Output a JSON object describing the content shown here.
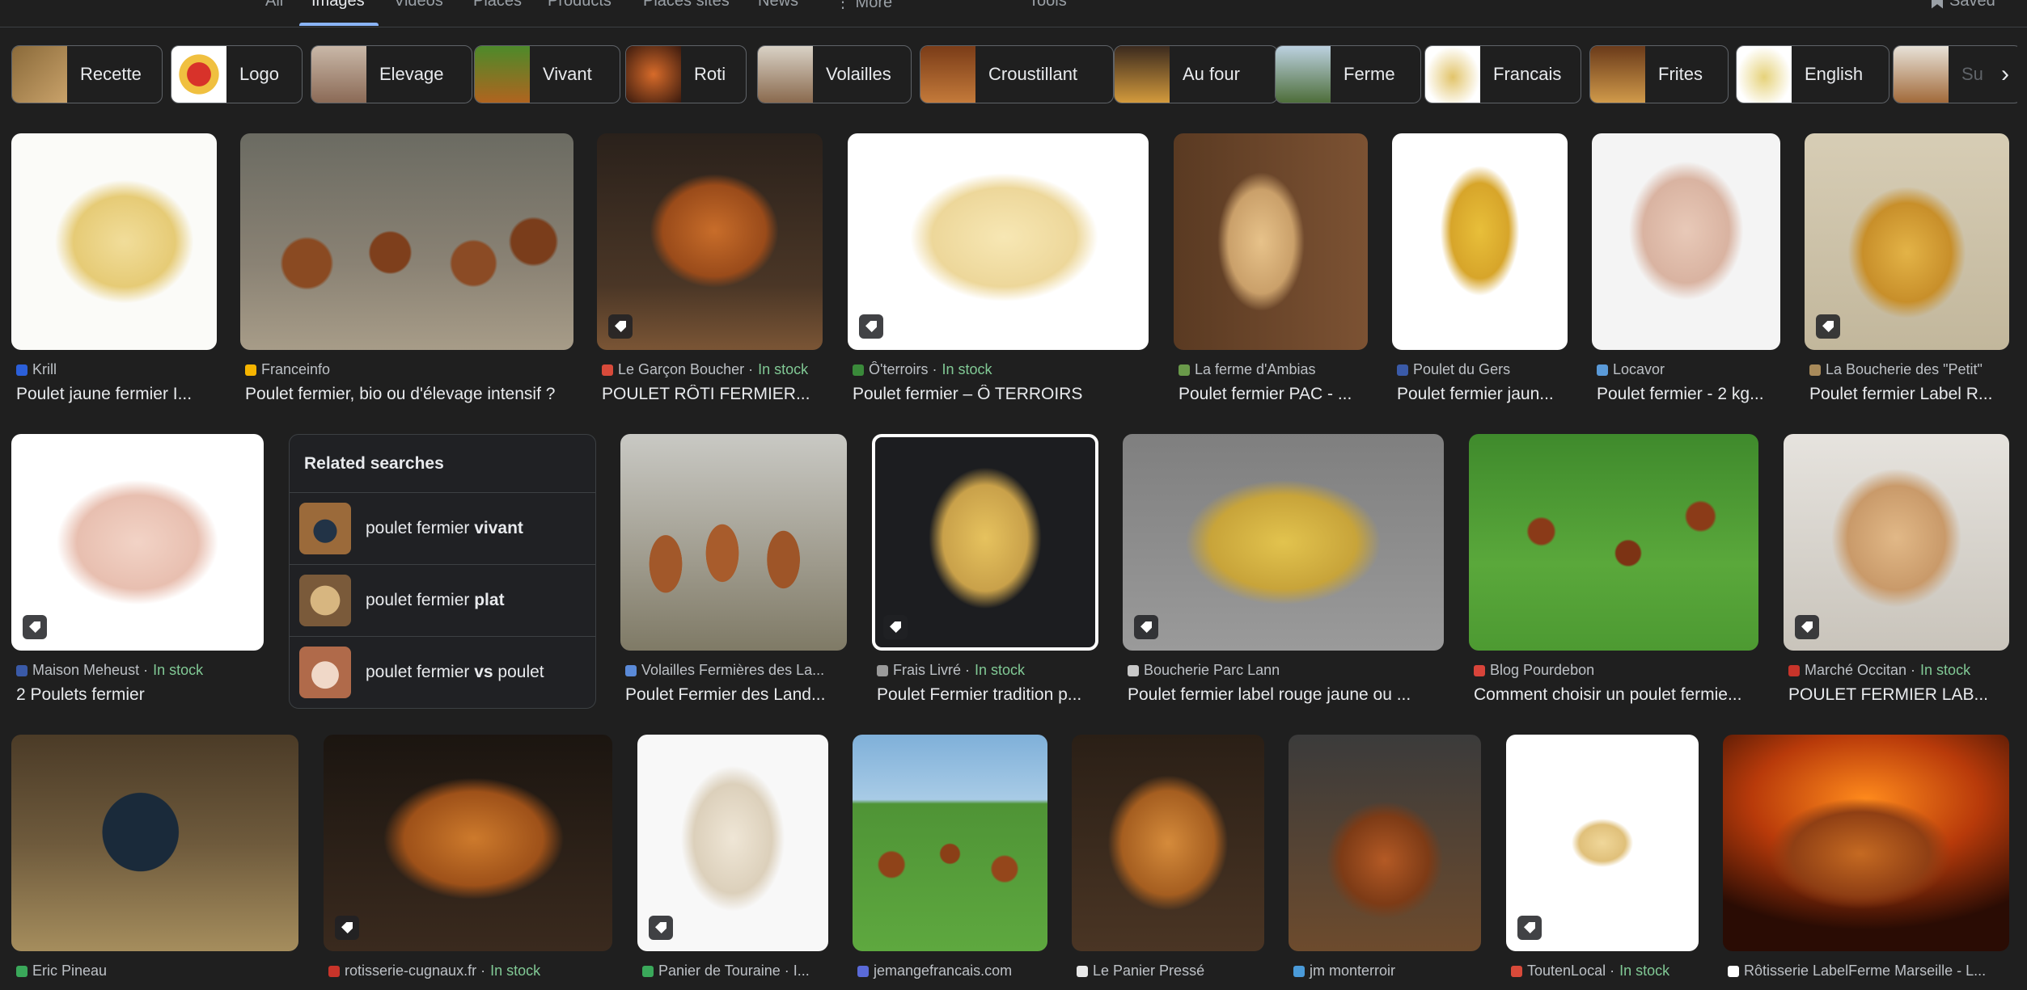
{
  "tabs": [
    "All",
    "Images",
    "Videos",
    "Places",
    "Products",
    "Places sites",
    "News",
    "⋮ More",
    "Tools"
  ],
  "saved_label": "Saved",
  "chips": [
    "Recette",
    "Logo",
    "Elevage",
    "Vivant",
    "Roti",
    "Volailles",
    "Croustillant",
    "Au four",
    "Ferme",
    "Francais",
    "Frites",
    "English",
    "Su"
  ],
  "chip_next": "›",
  "results": [
    {
      "source": "Krill",
      "stock": "",
      "title": "Poulet jaune fermier I..."
    },
    {
      "source": "Franceinfo",
      "stock": "",
      "title": "Poulet fermier, bio ou d'élevage intensif ?"
    },
    {
      "source": "Le Garçon Boucher · ",
      "stock": "In stock",
      "title": "POULET RÔTI FERMIER..."
    },
    {
      "source": "Ô'terroirs · ",
      "stock": "In stock",
      "title": "Poulet fermier – Ô TERROIRS"
    },
    {
      "source": "La ferme d'Ambias",
      "stock": "",
      "title": "Poulet fermier PAC - ..."
    },
    {
      "source": "Poulet du Gers",
      "stock": "",
      "title": "Poulet fermier jaun..."
    },
    {
      "source": "Locavor",
      "stock": "",
      "title": "Poulet fermier - 2 kg..."
    },
    {
      "source": "La Boucherie des \"Petit\"",
      "stock": "",
      "title": "Poulet fermier Label R..."
    },
    {
      "source": "Maison Meheust · ",
      "stock": "In stock",
      "title": "2 Poulets fermier"
    },
    {
      "source": "Volailles Fermières des La...",
      "stock": "",
      "title": "Poulet Fermier des Land..."
    },
    {
      "source": "Frais Livré · ",
      "stock": "In stock",
      "title": "Poulet Fermier tradition p..."
    },
    {
      "source": "Boucherie Parc Lann",
      "stock": "",
      "title": "Poulet fermier label rouge jaune ou ..."
    },
    {
      "source": "Blog Pourdebon",
      "stock": "",
      "title": "Comment choisir un poulet fermie..."
    },
    {
      "source": "Marché Occitan · ",
      "stock": "In stock",
      "title": "POULET FERMIER LAB..."
    },
    {
      "source": "Eric Pineau",
      "stock": "",
      "title": ""
    },
    {
      "source": "rotisserie-cugnaux.fr · ",
      "stock": "In stock",
      "title": ""
    },
    {
      "source": "Panier de Touraine · I...",
      "stock": "",
      "title": ""
    },
    {
      "source": "jemangefrancais.com",
      "stock": "",
      "title": ""
    },
    {
      "source": "Le Panier Pressé",
      "stock": "",
      "title": ""
    },
    {
      "source": "jm monterroir",
      "stock": "",
      "title": ""
    },
    {
      "source": "ToutenLocal · ",
      "stock": "In stock",
      "title": ""
    },
    {
      "source": "Rôtisserie LabelFerme Marseille - L...",
      "stock": "",
      "title": ""
    }
  ],
  "related": {
    "title": "Related searches",
    "items": [
      {
        "prefix": "poulet fermier ",
        "bold": "vivant",
        "suffix": ""
      },
      {
        "prefix": "poulet fermier ",
        "bold": "plat",
        "suffix": ""
      },
      {
        "prefix": "poulet fermier ",
        "bold": "vs",
        "suffix": " poulet"
      }
    ]
  },
  "colors": {
    "background": "#1f1f1f",
    "in_stock": "#81c995",
    "accent": "#8ab4f8"
  }
}
